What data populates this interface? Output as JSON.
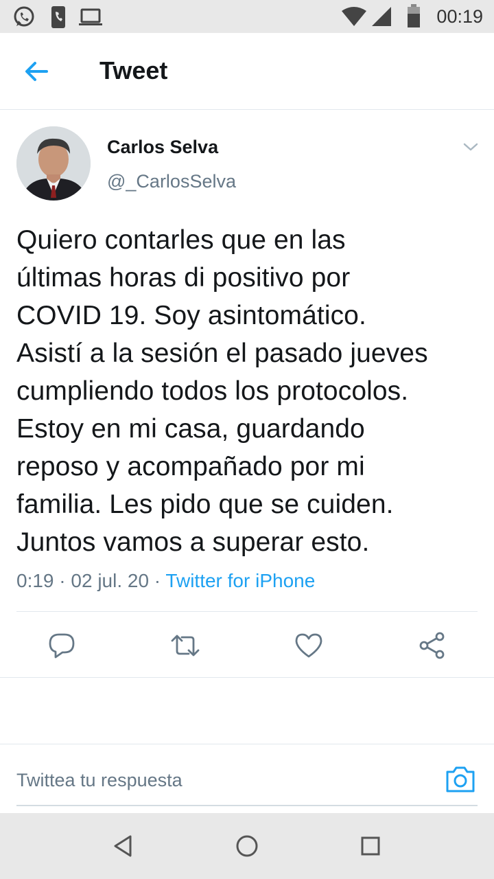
{
  "status_bar": {
    "time": "00:19",
    "icons": [
      "whatsapp-icon",
      "phone-notification-icon",
      "laptop-icon",
      "wifi-icon",
      "signal-icon",
      "battery-icon"
    ]
  },
  "header": {
    "back_icon": "arrow-left-icon",
    "title": "Tweet"
  },
  "tweet": {
    "author_name": "Carlos Selva",
    "author_handle": "@_CarlosSelva",
    "text": "Quiero contarles que en las\núltimas horas di positivo por\nCOVID 19. Soy asintomático.\nAsistí a la sesión el pasado jueves\ncumpliendo todos los protocolos.\nEstoy en mi casa, guardando\nreposo y acompañado por mi\nfamilia. Les pido que se cuiden.\nJuntos vamos a superar esto.",
    "time": "0:19",
    "date": "02 jul. 20",
    "separator": " · ",
    "source": "Twitter for iPhone",
    "actions": [
      "reply-icon",
      "retweet-icon",
      "like-icon",
      "share-icon"
    ]
  },
  "reply": {
    "placeholder": "Twittea tu respuesta",
    "camera_icon": "camera-icon"
  },
  "nav_bar": {
    "buttons": [
      "back-triangle-icon",
      "home-circle-icon",
      "recents-square-icon"
    ]
  },
  "colors": {
    "accent": "#1da1f2",
    "text": "#14171a",
    "secondary_text": "#657786",
    "divider": "#e1e8ed",
    "system_bar": "#e8e8e8"
  }
}
